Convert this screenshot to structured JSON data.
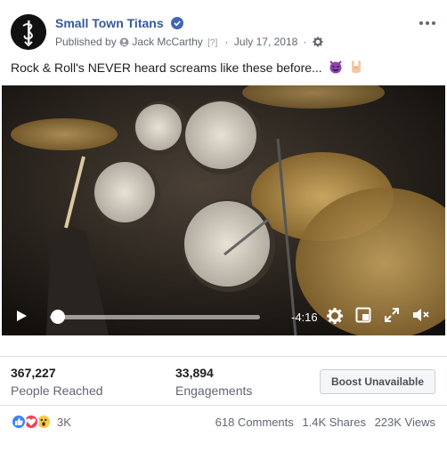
{
  "post": {
    "page_name": "Small Town Titans",
    "published_prefix": "Published by",
    "author": "Jack McCarthy",
    "help_marker": "[?]",
    "separator": "·",
    "date": "July 17, 2018",
    "text": "Rock & Roll's NEVER heard screams like these before...",
    "emojis": [
      "devil-emoji",
      "rock-hand-emoji"
    ]
  },
  "video": {
    "time_remaining": "-4:16",
    "progress_fraction": 0.04
  },
  "stats": {
    "reached_value": "367,227",
    "reached_label": "People Reached",
    "engagements_value": "33,894",
    "engagements_label": "Engagements",
    "boost_label": "Boost Unavailable"
  },
  "footer": {
    "reaction_icons": [
      "like-icon",
      "love-icon",
      "wow-icon"
    ],
    "reaction_count": "3K",
    "comments": "618 Comments",
    "shares": "1.4K Shares",
    "views": "223K Views"
  },
  "colors": {
    "link": "#365899",
    "verified": "#4267b2",
    "like": "#3b82f6",
    "love": "#f33e58"
  }
}
